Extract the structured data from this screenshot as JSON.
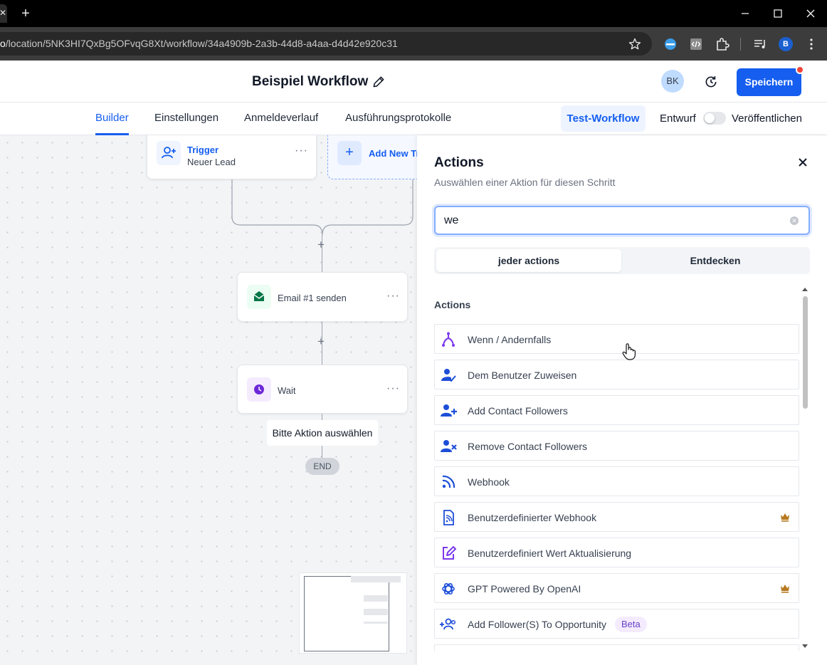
{
  "browser": {
    "url_prefix": "o",
    "url_path": "/location/5NK3HI7QxBg5OFvqG8Xt/workflow/34a4909b-2a3b-44d8-a4aa-d4d42e920c31",
    "new_tab_label": "+",
    "profile_initial": "B"
  },
  "header": {
    "title": "Beispiel Workflow",
    "avatar_initials": "BK",
    "save_label": "Speichern"
  },
  "tabs": [
    {
      "label": "Builder",
      "active": true
    },
    {
      "label": "Einstellungen"
    },
    {
      "label": "Anmeldeverlauf"
    },
    {
      "label": "Ausführungsprotokolle"
    }
  ],
  "toolbar": {
    "test_label": "Test-Workflow",
    "draft_label": "Entwurf",
    "publish_label": "Veröffentlichen"
  },
  "canvas": {
    "trigger_title": "Trigger",
    "trigger_subtitle": "Neuer Lead",
    "add_trigger_label": "Add New Tri",
    "email_node_label": "Email #1 senden",
    "wait_node_label": "Wait",
    "select_action_prompt": "Bitte Aktion auswählen",
    "end_label": "END",
    "plus_symbol": "+",
    "dots_symbol": "···"
  },
  "panel": {
    "title": "Actions",
    "subtitle": "Auswählen einer Aktion für diesen Schritt",
    "search_value": "we",
    "seg_all": "jeder actions",
    "seg_discover": "Entdecken",
    "section_label": "Actions",
    "items": [
      {
        "label": "Wenn / Andernfalls",
        "icon": "branch-icon",
        "color": "#7c3aed"
      },
      {
        "label": "Dem Benutzer Zuweisen",
        "icon": "assign-user-icon",
        "color": "#1d4ed8"
      },
      {
        "label": "Add Contact Followers",
        "icon": "user-plus-icon",
        "color": "#1d4ed8"
      },
      {
        "label": "Remove Contact Followers",
        "icon": "user-remove-icon",
        "color": "#1d4ed8"
      },
      {
        "label": "Webhook",
        "icon": "rss-icon",
        "color": "#1d4ed8"
      },
      {
        "label": "Benutzerdefinierter Webhook",
        "icon": "rss-document-icon",
        "color": "#1d4ed8",
        "premium": true
      },
      {
        "label": "Benutzerdefiniert Wert Aktualisierung",
        "icon": "edit-square-icon",
        "color": "#7c3aed"
      },
      {
        "label": "GPT Powered By OpenAI",
        "icon": "openai-icon",
        "color": "#1d4ed8",
        "premium": true
      },
      {
        "label": "Add Follower(S) To Opportunity",
        "icon": "users-plus-icon",
        "color": "#1d4ed8",
        "badge": "Beta"
      }
    ]
  },
  "colors": {
    "primary": "#155eef",
    "crown": "#b7791f",
    "email_icon": "#067647",
    "wait_icon": "#6d28d9"
  }
}
